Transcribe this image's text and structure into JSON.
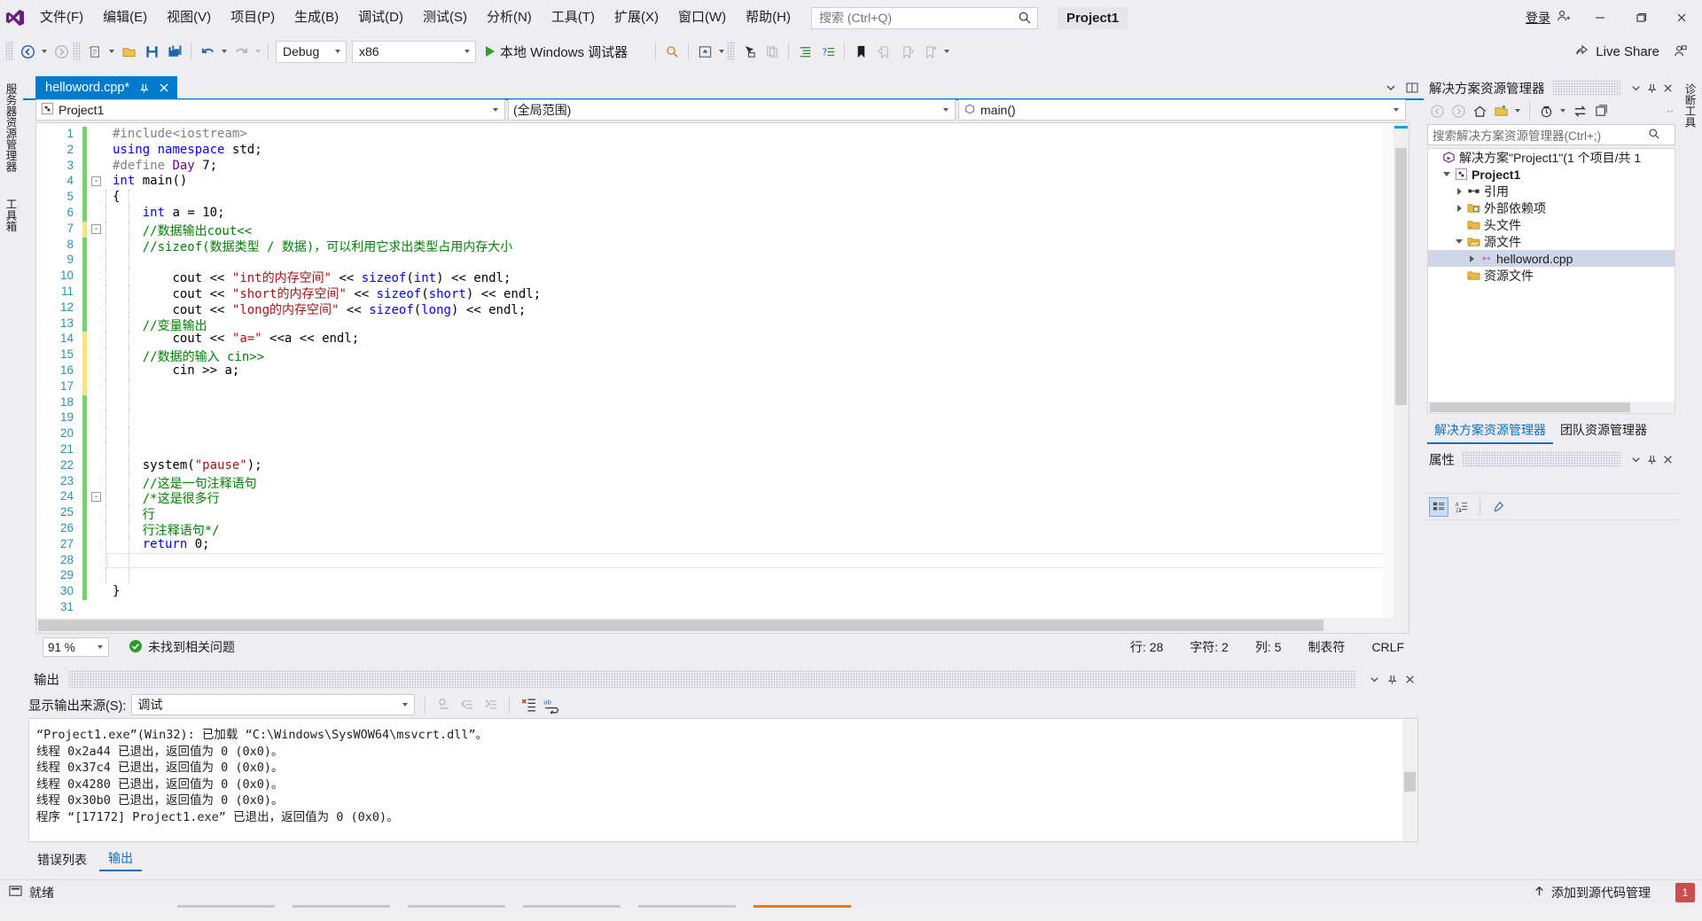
{
  "app": {
    "logo": "visual-studio-logo",
    "project_chip": "Project1"
  },
  "menu": [
    {
      "label": "文件(F)"
    },
    {
      "label": "编辑(E)"
    },
    {
      "label": "视图(V)"
    },
    {
      "label": "项目(P)"
    },
    {
      "label": "生成(B)"
    },
    {
      "label": "调试(D)"
    },
    {
      "label": "测试(S)"
    },
    {
      "label": "分析(N)"
    },
    {
      "label": "工具(T)"
    },
    {
      "label": "扩展(X)"
    },
    {
      "label": "窗口(W)"
    },
    {
      "label": "帮助(H)"
    }
  ],
  "search": {
    "placeholder": "搜索 (Ctrl+Q)",
    "value": ""
  },
  "account": {
    "signin_label": "登录"
  },
  "window_controls": {
    "minimize": "minimize",
    "maximize": "maximize",
    "close": "close"
  },
  "toolbar": {
    "config": "Debug",
    "platform": "x86",
    "run_label": "本地 Windows 调试器",
    "live_share_label": "Live Share"
  },
  "left_strip": [
    {
      "label": "服务器资源管理器"
    },
    {
      "label": "工具箱"
    }
  ],
  "right_strip": [
    {
      "label": "诊断工具"
    }
  ],
  "editor": {
    "tab_title": "helloword.cpp*",
    "nav": {
      "project": "Project1",
      "scope": "(全局范围)",
      "member": "main()"
    },
    "zoom": "91 %",
    "issue_text": "未找到相关问题",
    "status": {
      "line": "行: 28",
      "char": "字符: 2",
      "col": "列: 5",
      "tabs": "制表符",
      "eol": "CRLF"
    },
    "lines": [
      {
        "n": 1,
        "change": "green",
        "fold": "",
        "indent": 0,
        "html": "<span class='pp'>#include</span><span class='pp'>&lt;</span><span class='pp'>iostream</span><span class='pp'>&gt;</span>"
      },
      {
        "n": 2,
        "change": "green",
        "fold": "",
        "indent": 0,
        "html": "<span class='k'>using</span> <span class='k'>namespace</span> <span class='id'>std</span><span class='op'>;</span>"
      },
      {
        "n": 3,
        "change": "green",
        "fold": "",
        "indent": 0,
        "html": "<span class='pp'>#define</span> <span class='mac'>Day</span> <span class='id'>7</span><span class='op'>;</span>"
      },
      {
        "n": 4,
        "change": "green",
        "fold": "-",
        "indent": 0,
        "html": "<span class='k'>int</span> <span class='id'>main</span><span class='op'>()</span>"
      },
      {
        "n": 5,
        "change": "green",
        "fold": "",
        "indent": 1,
        "html": "<span class='op'>{</span>"
      },
      {
        "n": 6,
        "change": "green",
        "fold": "",
        "indent": 1,
        "html": "    <span class='k'>int</span> <span class='id'>a</span> <span class='op'>=</span> <span class='id'>10</span><span class='op'>;</span>"
      },
      {
        "n": 7,
        "change": "yellow",
        "fold": "-",
        "indent": 1,
        "html": "    <span class='cm'>//数据输出cout&lt;&lt;</span>"
      },
      {
        "n": 8,
        "change": "green",
        "fold": "",
        "indent": 1,
        "html": "    <span class='cm'>//sizeof(数据类型 / 数据)，可以利用它求出类型占用内存大小</span>"
      },
      {
        "n": 9,
        "change": "green",
        "fold": "",
        "indent": 1,
        "html": ""
      },
      {
        "n": 10,
        "change": "green",
        "fold": "",
        "indent": 1,
        "html": "        <span class='id'>cout</span> <span class='op'>&lt;&lt;</span> <span class='st'>\"int的内存空间\"</span> <span class='op'>&lt;&lt;</span> <span class='k'>sizeof</span><span class='op'>(</span><span class='k'>int</span><span class='op'>)</span> <span class='op'>&lt;&lt;</span> <span class='id'>endl</span><span class='op'>;</span>"
      },
      {
        "n": 11,
        "change": "green",
        "fold": "",
        "indent": 1,
        "html": "        <span class='id'>cout</span> <span class='op'>&lt;&lt;</span> <span class='st'>\"short的内存空间\"</span> <span class='op'>&lt;&lt;</span> <span class='k'>sizeof</span><span class='op'>(</span><span class='k'>short</span><span class='op'>)</span> <span class='op'>&lt;&lt;</span> <span class='id'>endl</span><span class='op'>;</span>"
      },
      {
        "n": 12,
        "change": "green",
        "fold": "",
        "indent": 1,
        "html": "        <span class='id'>cout</span> <span class='op'>&lt;&lt;</span> <span class='st'>\"long的内存空间\"</span> <span class='op'>&lt;&lt;</span> <span class='k'>sizeof</span><span class='op'>(</span><span class='k'>long</span><span class='op'>)</span> <span class='op'>&lt;&lt;</span> <span class='id'>endl</span><span class='op'>;</span>"
      },
      {
        "n": 13,
        "change": "green",
        "fold": "",
        "indent": 1,
        "html": "    <span class='cm'>//变量输出</span>"
      },
      {
        "n": 14,
        "change": "yellow",
        "fold": "",
        "indent": 1,
        "html": "        <span class='id'>cout</span> <span class='op'>&lt;&lt;</span> <span class='st'>\"a=\"</span> <span class='op'>&lt;&lt;</span><span class='id'>a</span> <span class='op'>&lt;&lt;</span> <span class='id'>endl</span><span class='op'>;</span>"
      },
      {
        "n": 15,
        "change": "yellow",
        "fold": "",
        "indent": 1,
        "html": "    <span class='cm'>//数据的输入 cin&gt;&gt;</span>"
      },
      {
        "n": 16,
        "change": "yellow",
        "fold": "",
        "indent": 1,
        "html": "        <span class='id'>cin</span> <span class='op'>&gt;&gt;</span> <span class='id'>a</span><span class='op'>;</span>"
      },
      {
        "n": 17,
        "change": "yellow",
        "fold": "",
        "indent": 1,
        "html": ""
      },
      {
        "n": 18,
        "change": "green",
        "fold": "",
        "indent": 1,
        "html": ""
      },
      {
        "n": 19,
        "change": "green",
        "fold": "",
        "indent": 1,
        "html": ""
      },
      {
        "n": 20,
        "change": "green",
        "fold": "",
        "indent": 1,
        "html": ""
      },
      {
        "n": 21,
        "change": "green",
        "fold": "",
        "indent": 1,
        "html": ""
      },
      {
        "n": 22,
        "change": "green",
        "fold": "",
        "indent": 1,
        "html": "    <span class='id'>system</span><span class='op'>(</span><span class='st'>\"pause\"</span><span class='op'>);</span>"
      },
      {
        "n": 23,
        "change": "green",
        "fold": "",
        "indent": 1,
        "html": "    <span class='cm'>//这是一句注释语句</span>"
      },
      {
        "n": 24,
        "change": "green",
        "fold": "-",
        "indent": 1,
        "html": "    <span class='cm'>/*这是很多行</span>"
      },
      {
        "n": 25,
        "change": "green",
        "fold": "",
        "indent": 1,
        "html": "    <span class='cm'>行</span>"
      },
      {
        "n": 26,
        "change": "green",
        "fold": "",
        "indent": 1,
        "html": "    <span class='cm'>行注释语句*/</span>"
      },
      {
        "n": 27,
        "change": "green",
        "fold": "",
        "indent": 1,
        "html": "    <span class='k'>return</span> <span class='id'>0</span><span class='op'>;</span>"
      },
      {
        "n": 28,
        "change": "green",
        "fold": "",
        "indent": 1,
        "html": ""
      },
      {
        "n": 29,
        "change": "green",
        "fold": "",
        "indent": 1,
        "html": ""
      },
      {
        "n": 30,
        "change": "green",
        "fold": "",
        "indent": 0,
        "html": "<span class='op'>}</span>"
      },
      {
        "n": 31,
        "change": "",
        "fold": "",
        "indent": 0,
        "html": ""
      }
    ]
  },
  "output_panel": {
    "title": "输出",
    "source_label": "显示输出来源(S):",
    "source_value": "调试",
    "lines": [
      "“Project1.exe”(Win32): 已加载 “C:\\Windows\\SysWOW64\\msvcrt.dll”。",
      "线程 0x2a44 已退出，返回值为 0 (0x0)。",
      "线程 0x37c4 已退出，返回值为 0 (0x0)。",
      "线程 0x4280 已退出，返回值为 0 (0x0)。",
      "线程 0x30b0 已退出，返回值为 0 (0x0)。",
      "程序 “[17172] Project1.exe” 已退出，返回值为 0 (0x0)。"
    ],
    "tabs": [
      {
        "label": "错误列表",
        "active": false
      },
      {
        "label": "输出",
        "active": true
      }
    ]
  },
  "solution_explorer": {
    "title": "解决方案资源管理器",
    "search_placeholder": "搜索解决方案资源管理器(Ctrl+;)",
    "tree": [
      {
        "label": "解决方案\"Project1\"(1 个项目/共 1",
        "depth": 0,
        "twisty": "",
        "icon": "solution-icon",
        "bold": false,
        "selected": false
      },
      {
        "label": "Project1",
        "depth": 1,
        "twisty": "down",
        "icon": "project-icon",
        "bold": true,
        "selected": false
      },
      {
        "label": "引用",
        "depth": 2,
        "twisty": "right",
        "icon": "references-icon",
        "bold": false,
        "selected": false
      },
      {
        "label": "外部依赖项",
        "depth": 2,
        "twisty": "right",
        "icon": "folder-ext-icon",
        "bold": false,
        "selected": false
      },
      {
        "label": "头文件",
        "depth": 2,
        "twisty": "",
        "icon": "folder-icon",
        "bold": false,
        "selected": false
      },
      {
        "label": "源文件",
        "depth": 2,
        "twisty": "down",
        "icon": "folder-open-icon",
        "bold": false,
        "selected": false
      },
      {
        "label": "helloword.cpp",
        "depth": 3,
        "twisty": "right",
        "icon": "cpp-file-icon",
        "bold": false,
        "selected": true
      },
      {
        "label": "资源文件",
        "depth": 2,
        "twisty": "",
        "icon": "folder-icon",
        "bold": false,
        "selected": false
      }
    ],
    "tabs": [
      {
        "label": "解决方案资源管理器",
        "active": true
      },
      {
        "label": "团队资源管理器",
        "active": false
      }
    ]
  },
  "properties_panel": {
    "title": "属性"
  },
  "statusbar": {
    "ready": "就绪",
    "source_control": "添加到源代码管理",
    "notification_count": "1"
  },
  "colors": {
    "accent": "#007acc",
    "chrome": "#eeeef2",
    "tab_active": "#007acc",
    "change_added": "#6fd66f",
    "change_modified": "#ffe37a",
    "error_red": "#c94f4f",
    "link_blue": "#0e70c0"
  }
}
